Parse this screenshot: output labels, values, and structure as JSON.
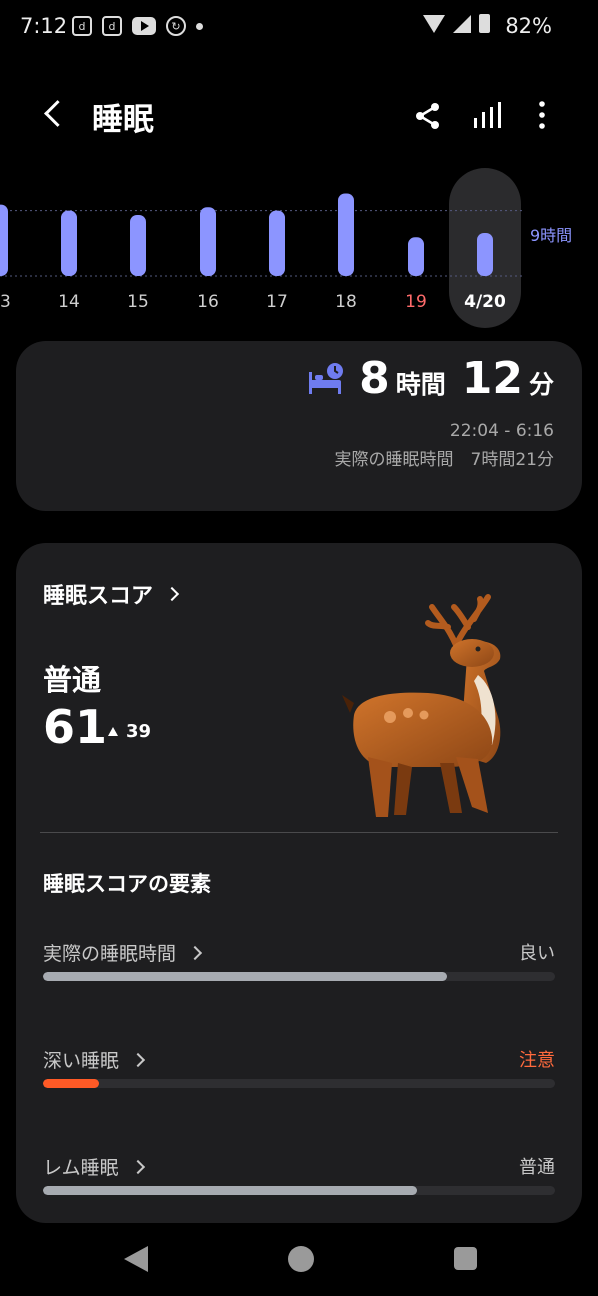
{
  "status_bar": {
    "time": "7:12",
    "battery": "82%",
    "icons": [
      "d-app-icon",
      "d-app-icon",
      "youtube-icon",
      "sync-icon",
      "dot-icon",
      "wifi-icon",
      "signal-icon",
      "battery-icon"
    ]
  },
  "header": {
    "title": "睡眠",
    "actions": [
      "share-icon",
      "stats-icon",
      "more-icon"
    ]
  },
  "chart_data": {
    "type": "bar",
    "categories": [
      "13",
      "14",
      "15",
      "16",
      "17",
      "18",
      "19",
      "4/20"
    ],
    "values": [
      8.3,
      7.6,
      7.1,
      8.0,
      7.6,
      9.6,
      4.5,
      5.0
    ],
    "reference_label": "9時間",
    "reference_value": 9,
    "bar_color": "#8c95ff",
    "highlight_category": "19",
    "highlight_color": "#ff6b6b",
    "selected_category": "4/20"
  },
  "sleep_summary": {
    "hours": "8",
    "hours_unit": "時間",
    "minutes": "12",
    "minutes_unit": "分",
    "time_range": "22:04 - 6:16",
    "actual_sleep": "実際の睡眠時間　7時間21分"
  },
  "sleep_score": {
    "title": "睡眠スコア",
    "status": "普通",
    "score": "61",
    "delta": "39",
    "factors_title": "睡眠スコアの要素",
    "factors": [
      {
        "label": "実際の睡眠時間",
        "value": "良い",
        "level": 0.79,
        "color": "#a7abb1"
      },
      {
        "label": "深い睡眠",
        "value": "注意",
        "level": 0.11,
        "color": "#ff5a26"
      },
      {
        "label": "レム睡眠",
        "value": "普通",
        "level": 0.73,
        "color": "#a7abb1"
      }
    ]
  },
  "nav": [
    "back-icon",
    "home-icon",
    "recents-icon"
  ]
}
